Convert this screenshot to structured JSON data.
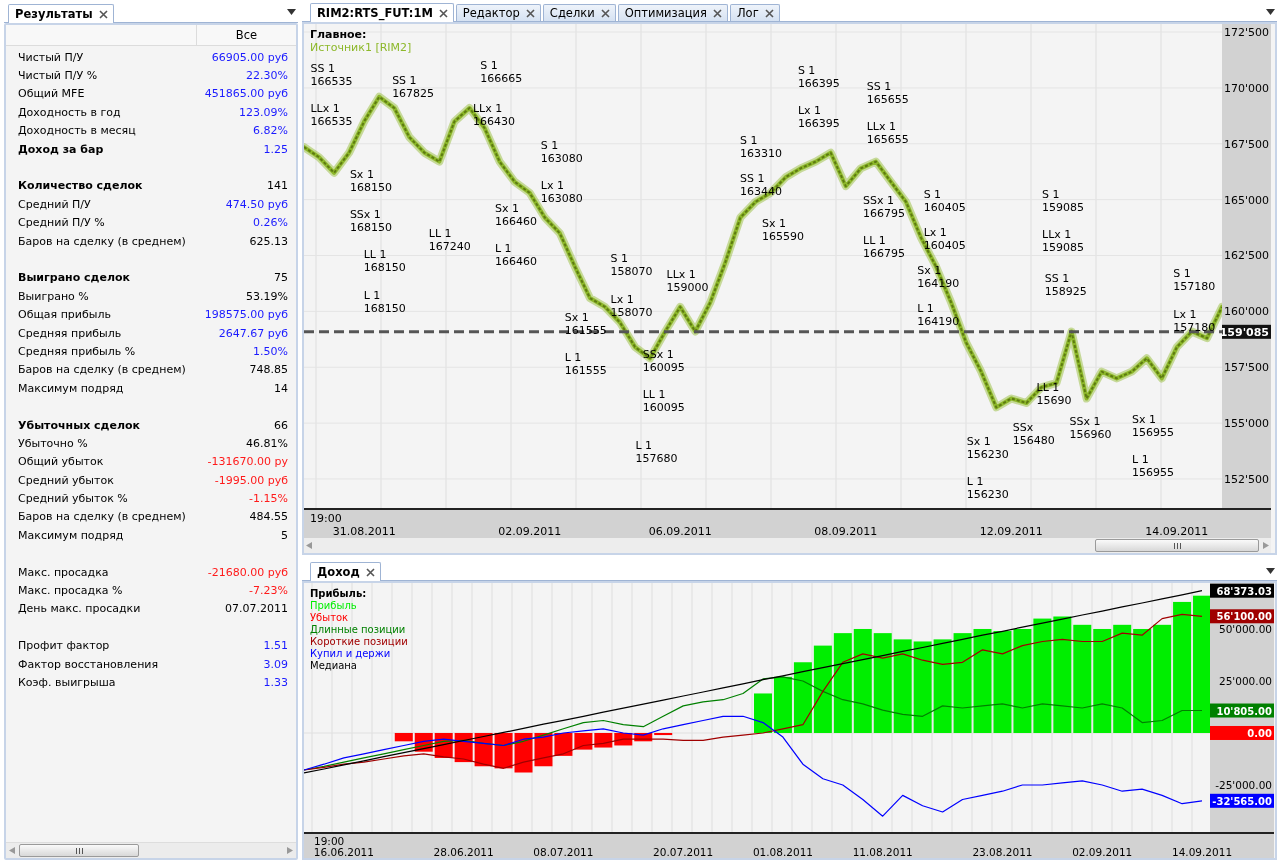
{
  "results_panel": {
    "tab": {
      "label": "Результаты",
      "selected": true
    },
    "column_header": "Все",
    "rows": [
      {
        "kind": "stat",
        "label": "Чистый П/У",
        "value": "66905.00 руб",
        "color": "#1a1aff"
      },
      {
        "kind": "stat",
        "label": "Чистый П/У %",
        "value": "22.30%",
        "color": "#1a1aff"
      },
      {
        "kind": "stat",
        "label": "Общий MFE",
        "value": "451865.00 руб",
        "color": "#1a1aff"
      },
      {
        "kind": "stat",
        "label": "Доходность в год",
        "value": "123.09%",
        "color": "#1a1aff"
      },
      {
        "kind": "stat",
        "label": "Доходность в месяц",
        "value": "6.82%",
        "color": "#1a1aff"
      },
      {
        "kind": "heading",
        "label": "Доход за бар",
        "value": "1.25",
        "color": "#1a1aff"
      },
      {
        "kind": "gap"
      },
      {
        "kind": "heading",
        "label": "Количество сделок",
        "value": "141",
        "color": "#000000"
      },
      {
        "kind": "stat",
        "label": "Средний П/У",
        "value": "474.50 руб",
        "color": "#1a1aff"
      },
      {
        "kind": "stat",
        "label": "Средний П/У %",
        "value": "0.26%",
        "color": "#1a1aff"
      },
      {
        "kind": "stat",
        "label": "Баров на сделку (в среднем)",
        "value": "625.13",
        "color": "#000000"
      },
      {
        "kind": "gap"
      },
      {
        "kind": "heading",
        "label": "Выиграно сделок",
        "value": "75",
        "color": "#000000"
      },
      {
        "kind": "stat",
        "label": "Выиграно %",
        "value": "53.19%",
        "color": "#000000"
      },
      {
        "kind": "stat",
        "label": "Общая прибыль",
        "value": "198575.00 руб",
        "color": "#1a1aff"
      },
      {
        "kind": "stat",
        "label": "Средняя прибыль",
        "value": "2647.67 руб",
        "color": "#1a1aff"
      },
      {
        "kind": "stat",
        "label": "Средняя прибыль %",
        "value": "1.50%",
        "color": "#1a1aff"
      },
      {
        "kind": "stat",
        "label": "Баров на сделку (в среднем)",
        "value": "748.85",
        "color": "#000000"
      },
      {
        "kind": "stat",
        "label": "Максимум подряд",
        "value": "14",
        "color": "#000000"
      },
      {
        "kind": "gap"
      },
      {
        "kind": "heading",
        "label": "Убыточных сделок",
        "value": "66",
        "color": "#000000"
      },
      {
        "kind": "stat",
        "label": "Убыточно %",
        "value": "46.81%",
        "color": "#000000"
      },
      {
        "kind": "stat",
        "label": "Общий убыток",
        "value": "-131670.00 ру",
        "color": "#ff1a1a"
      },
      {
        "kind": "stat",
        "label": "Средний убыток",
        "value": "-1995.00 руб",
        "color": "#ff1a1a"
      },
      {
        "kind": "stat",
        "label": "Средний убыток %",
        "value": "-1.15%",
        "color": "#ff1a1a"
      },
      {
        "kind": "stat",
        "label": "Баров на сделку (в среднем)",
        "value": "484.55",
        "color": "#000000"
      },
      {
        "kind": "stat",
        "label": "Максимум подряд",
        "value": "5",
        "color": "#000000"
      },
      {
        "kind": "gap"
      },
      {
        "kind": "stat",
        "label": "Макс. просадка",
        "value": "-21680.00 руб",
        "color": "#ff1a1a"
      },
      {
        "kind": "stat",
        "label": "Макс. просадка %",
        "value": "-7.23%",
        "color": "#ff1a1a"
      },
      {
        "kind": "stat",
        "label": "День макс. просадки",
        "value": "07.07.2011",
        "color": "#000000"
      },
      {
        "kind": "gap"
      },
      {
        "kind": "stat",
        "label": "Профит фактор",
        "value": "1.51",
        "color": "#1a1aff"
      },
      {
        "kind": "stat",
        "label": "Фактор восстановления",
        "value": "3.09",
        "color": "#1a1aff"
      },
      {
        "kind": "stat",
        "label": "Коэф. выигрыша",
        "value": "1.33",
        "color": "#1a1aff"
      }
    ]
  },
  "main_tabs": [
    {
      "label": "RIM2:RTS_FUT:1M",
      "selected": true
    },
    {
      "label": "Редактор",
      "selected": false
    },
    {
      "label": "Сделки",
      "selected": false
    },
    {
      "label": "Оптимизация",
      "selected": false
    },
    {
      "label": "Лог",
      "selected": false
    }
  ],
  "price_panel": {
    "time_label": "19:00",
    "chart_data": {
      "type": "line",
      "title": "Главное:",
      "grid": true,
      "ylim": [
        151200,
        172860
      ],
      "categories": [
        null,
        null,
        null,
        null,
        "31.08.2011",
        null,
        null,
        null,
        null,
        null,
        null,
        null,
        null,
        null,
        null,
        "02.09.2011",
        null,
        null,
        null,
        null,
        null,
        null,
        null,
        null,
        null,
        "06.09.2011",
        null,
        null,
        null,
        null,
        null,
        null,
        null,
        null,
        null,
        null,
        "08.09.2011",
        null,
        null,
        null,
        null,
        null,
        null,
        null,
        null,
        null,
        null,
        "12.09.2011",
        null,
        null,
        null,
        null,
        null,
        null,
        null,
        null,
        null,
        null,
        "14.09.2011",
        null,
        null,
        null
      ],
      "series": [
        {
          "name": "Источник1 [RIM2]",
          "color": "#8db82a",
          "values": [
            167350,
            166900,
            166200,
            167100,
            168500,
            169600,
            169100,
            167800,
            167100,
            166700,
            168500,
            169100,
            168200,
            166700,
            165800,
            165300,
            164200,
            163500,
            162000,
            160600,
            160200,
            159500,
            158400,
            157900,
            159100,
            160200,
            159100,
            160400,
            162200,
            164200,
            164900,
            165300,
            166000,
            166400,
            166700,
            167100,
            165600,
            166400,
            166700,
            165800,
            164900,
            163300,
            162000,
            160400,
            158600,
            157300,
            155700,
            156100,
            155900,
            156600,
            156800,
            159100,
            156100,
            157300,
            157000,
            157300,
            157900,
            157000,
            158400,
            159100,
            158800,
            160200
          ]
        }
      ],
      "ref_lines": [
        {
          "axis": "y",
          "value": 159085,
          "label": "159'085"
        }
      ],
      "yticks": [
        {
          "value": 172500,
          "label": "172'500"
        },
        {
          "value": 170000,
          "label": "170'000"
        },
        {
          "value": 167500,
          "label": "167'500"
        },
        {
          "value": 165000,
          "label": "165'000"
        },
        {
          "value": 162500,
          "label": "162'500"
        },
        {
          "value": 160000,
          "label": "160'000"
        },
        {
          "value": 157500,
          "label": "157'500"
        },
        {
          "value": 155000,
          "label": "155'000"
        },
        {
          "value": 152500,
          "label": "152'500"
        }
      ],
      "annotations": [
        "SS 1\n166535",
        "LLx 1\n166535",
        "SS 1\n167825",
        "Sx 1\n168150",
        "SSx 1\n168150",
        "LL 1\n168150",
        "L 1\n168150",
        "LL 1\n167240",
        "S 1\n166665",
        "LLx 1\n166430",
        "Sx 1\n166460",
        "L 1\n166460",
        "S 1\n163080",
        "Lx 1\n163080",
        "S 1\n158070",
        "Lx 1\n158070",
        "Sx 1\n161555",
        "L 1\n161555",
        "LLx 1\n159000",
        "SSx 1\n160095",
        "LL 1\n160095",
        "L 1\n157680",
        "S 1\n163310",
        "SS 1\n163440",
        "Sx 1\n165590",
        "S 1\n166395",
        "Lx 1\n166395",
        "SS 1\n165655",
        "LLx 1\n165655",
        "SSx 1\n166795",
        "LL 1\n166795",
        "S 1\n160405",
        "Lx 1\n160405",
        "Sx 1\n164190",
        "L 1\n164190",
        "S 1\n159085",
        "LLx 1\n159085",
        "SS 1\n158925",
        "Sx 1\n156230",
        "L 1\n156230",
        "SSx\n156480",
        "LL 1\n15690",
        "SSx 1\n156960",
        "Sx 1\n156955",
        "L 1\n156955",
        "S 1\n157180",
        "Lx 1\n157180"
      ]
    }
  },
  "income_panel": {
    "tab": {
      "label": "Доход",
      "selected": true
    },
    "time_label": "19:00",
    "axis_badges": [
      {
        "text": "68'373.03",
        "color": "#000000"
      },
      {
        "text": "56'100.00",
        "color": "#a00000"
      },
      {
        "text": "10'805.00",
        "color": "#008000"
      },
      {
        "text": "0.00",
        "color": "#ff0000"
      },
      {
        "text": "-32'565.00",
        "color": "#0000ff"
      }
    ],
    "chart_data": {
      "type": "bar",
      "title": "Прибыль:",
      "grid": true,
      "ylim": [
        -47600,
        72100
      ],
      "categories": [
        null,
        null,
        "16.06.2011",
        null,
        null,
        null,
        null,
        null,
        "28.06.2011",
        null,
        null,
        null,
        null,
        "08.07.2011",
        null,
        null,
        null,
        null,
        null,
        "20.07.2011",
        null,
        null,
        null,
        null,
        "01.08.2011",
        null,
        null,
        null,
        null,
        "11.08.2011",
        null,
        null,
        null,
        null,
        null,
        "23.08.2011",
        null,
        null,
        null,
        null,
        "02.09.2011",
        null,
        null,
        null,
        null,
        "14.09.2011"
      ],
      "series": [
        {
          "name": "Прибыль",
          "type": "bar",
          "color": "#00ee00",
          "values": [
            null,
            null,
            null,
            null,
            null,
            null,
            null,
            null,
            null,
            null,
            null,
            null,
            null,
            null,
            null,
            null,
            null,
            null,
            null,
            null,
            null,
            null,
            null,
            19000,
            27000,
            34000,
            42000,
            48000,
            50000,
            48000,
            45000,
            44000,
            45000,
            48000,
            50000,
            49000,
            50000,
            55000,
            56000,
            52000,
            50000,
            52000,
            50000,
            52000,
            63000,
            66000
          ]
        },
        {
          "name": "Убыток",
          "type": "bar",
          "color": "#ff0000",
          "values": [
            null,
            null,
            null,
            null,
            null,
            -4000,
            -9000,
            -12000,
            -14000,
            -16000,
            -17000,
            -19000,
            -16000,
            -11000,
            -8000,
            -7000,
            -6000,
            -4000,
            -1000,
            null,
            null,
            null,
            null,
            null,
            null,
            null,
            null,
            null,
            null,
            null,
            null,
            null,
            null,
            null,
            null,
            null,
            null,
            null,
            null,
            null,
            null,
            null,
            null,
            null,
            null,
            null
          ]
        },
        {
          "name": "Длинные позиции",
          "type": "line",
          "color": "#008000",
          "values": [
            -17800,
            -16000,
            -14000,
            -12000,
            -10000,
            -8000,
            -6000,
            -4000,
            -3500,
            -5000,
            -6000,
            -4000,
            -1000,
            2000,
            5000,
            6000,
            4000,
            3000,
            8000,
            13000,
            15000,
            16000,
            19000,
            26000,
            27000,
            25000,
            20000,
            16000,
            14000,
            11000,
            9000,
            8000,
            13000,
            12000,
            13000,
            14000,
            12000,
            14000,
            13000,
            12000,
            14000,
            12000,
            5000,
            6000,
            10800,
            10800
          ]
        },
        {
          "name": "Короткие позиции",
          "type": "line",
          "color": "#a00000",
          "values": [
            -17800,
            -16500,
            -15000,
            -14000,
            -12500,
            -11000,
            -10000,
            -11500,
            -12500,
            -15000,
            -17000,
            -14000,
            -12000,
            -10000,
            -6000,
            -5000,
            -3000,
            -3000,
            -3000,
            -3500,
            -3500,
            -2000,
            -1000,
            0,
            2000,
            4000,
            20000,
            34000,
            38000,
            36000,
            38000,
            35000,
            33000,
            34000,
            40000,
            38000,
            42000,
            44000,
            45000,
            44000,
            44000,
            48000,
            47000,
            55000,
            57000,
            56100
          ]
        },
        {
          "name": "Купил и держи",
          "type": "line",
          "color": "#0000ff",
          "values": [
            -17800,
            -15000,
            -12000,
            -10000,
            -8000,
            -6000,
            -4000,
            -3000,
            -4000,
            -5000,
            -6000,
            -3000,
            -2000,
            0,
            1000,
            2000,
            0,
            -1000,
            2000,
            4000,
            6000,
            8000,
            8000,
            5000,
            -2000,
            -15000,
            -22000,
            -25000,
            -32000,
            -40000,
            -30000,
            -35000,
            -38000,
            -32000,
            -30000,
            -28000,
            -25000,
            -25000,
            -24000,
            -23000,
            -25000,
            -28000,
            -27000,
            -30000,
            -34000,
            -32600
          ]
        },
        {
          "name": "Медиана",
          "type": "line",
          "color": "#000000",
          "values": [
            -19200,
            -17300,
            -15300,
            -13400,
            -11400,
            -9500,
            -7500,
            -5600,
            -3600,
            -1700,
            300,
            2200,
            4200,
            6100,
            8000,
            10000,
            11900,
            13900,
            15800,
            17800,
            19700,
            21700,
            23600,
            25600,
            27500,
            29500,
            31400,
            33300,
            35300,
            37200,
            39200,
            41100,
            43100,
            45000,
            47000,
            48900,
            50900,
            52800,
            54700,
            56700,
            58600,
            60600,
            62500,
            64500,
            66400,
            68400
          ]
        }
      ],
      "yticks": [
        {
          "value": 50000,
          "label": "50'000.00"
        },
        {
          "value": 25000,
          "label": "25'000.00"
        },
        {
          "value": -25000,
          "label": "-25'000.00"
        }
      ]
    }
  }
}
